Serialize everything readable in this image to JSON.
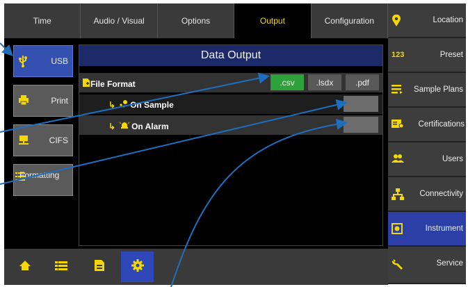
{
  "tabs": [
    {
      "label": "Time"
    },
    {
      "label": "Audio / Visual"
    },
    {
      "label": "Options"
    },
    {
      "label": "Output"
    },
    {
      "label": "Configuration"
    }
  ],
  "left_nav": [
    {
      "label": "USB",
      "icon": "usb-icon"
    },
    {
      "label": "Print",
      "icon": "printer-icon"
    },
    {
      "label": "CIFS",
      "icon": "network-share-icon"
    },
    {
      "label": "Formatting",
      "icon": "formatting-list-icon"
    }
  ],
  "panel": {
    "title": "Data Output",
    "file_format_label": "File Format",
    "formats": [
      ".csv",
      ".lsdx",
      ".pdf"
    ],
    "selected_format": ".csv",
    "on_sample_label": "On Sample",
    "on_alarm_label": "On Alarm",
    "arrow_glyph": "↳"
  },
  "right_nav": [
    {
      "label": "Location",
      "icon": "location-pin-icon"
    },
    {
      "label": "Preset",
      "icon": "preset-123-icon",
      "icon_text": "123"
    },
    {
      "label": "Sample Plans",
      "icon": "sample-plans-icon"
    },
    {
      "label": "Certifications",
      "icon": "certifications-icon"
    },
    {
      "label": "Users",
      "icon": "users-icon"
    },
    {
      "label": "Connectivity",
      "icon": "connectivity-icon"
    },
    {
      "label": "Instrument",
      "icon": "instrument-icon"
    },
    {
      "label": "Service",
      "icon": "wrench-icon"
    }
  ],
  "colors": {
    "accent_yellow": "#f5d800",
    "active_blue": "#3451b2",
    "selected_green": "#2ea23a",
    "callout_line": "#1f6fc0"
  }
}
